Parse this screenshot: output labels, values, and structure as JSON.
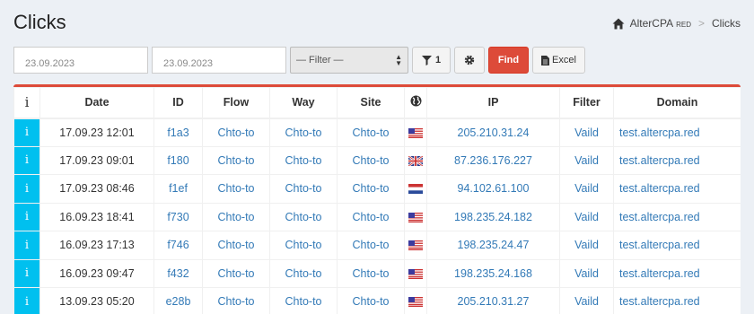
{
  "page": {
    "title": "Clicks"
  },
  "breadcrumb": {
    "brand": "AlterCPA",
    "brand_suffix": "RED",
    "separator": ">",
    "current": "Clicks",
    "home_icon": "home-icon"
  },
  "toolbar": {
    "date_from": "23.09.2023",
    "date_to": "23.09.2023",
    "filter_selected": "— Filter —",
    "filter_count": "1",
    "find_label": "Find",
    "excel_label": "Excel",
    "colors": {
      "find": "#dd4b39"
    }
  },
  "table": {
    "headers": {
      "info": "i",
      "date": "Date",
      "id": "ID",
      "flow": "Flow",
      "way": "Way",
      "site": "Site",
      "geo_icon": "globe-icon",
      "ip": "IP",
      "filter": "Filter",
      "domain": "Domain"
    },
    "rows": [
      {
        "info": "i",
        "date": "17.09.23 12:01",
        "id": "f1a3",
        "flow": "Chto-to",
        "way": "Chto-to",
        "site": "Chto-to",
        "flag": "us",
        "ip": "205.210.31.24",
        "filter": "Vaild",
        "domain": "test.altercpa.red"
      },
      {
        "info": "i",
        "date": "17.09.23 09:01",
        "id": "f180",
        "flow": "Chto-to",
        "way": "Chto-to",
        "site": "Chto-to",
        "flag": "gb",
        "ip": "87.236.176.227",
        "filter": "Vaild",
        "domain": "test.altercpa.red"
      },
      {
        "info": "i",
        "date": "17.09.23 08:46",
        "id": "f1ef",
        "flow": "Chto-to",
        "way": "Chto-to",
        "site": "Chto-to",
        "flag": "nl",
        "ip": "94.102.61.100",
        "filter": "Vaild",
        "domain": "test.altercpa.red"
      },
      {
        "info": "i",
        "date": "16.09.23 18:41",
        "id": "f730",
        "flow": "Chto-to",
        "way": "Chto-to",
        "site": "Chto-to",
        "flag": "us",
        "ip": "198.235.24.182",
        "filter": "Vaild",
        "domain": "test.altercpa.red"
      },
      {
        "info": "i",
        "date": "16.09.23 17:13",
        "id": "f746",
        "flow": "Chto-to",
        "way": "Chto-to",
        "site": "Chto-to",
        "flag": "us",
        "ip": "198.235.24.47",
        "filter": "Vaild",
        "domain": "test.altercpa.red"
      },
      {
        "info": "i",
        "date": "16.09.23 09:47",
        "id": "f432",
        "flow": "Chto-to",
        "way": "Chto-to",
        "site": "Chto-to",
        "flag": "us",
        "ip": "198.235.24.168",
        "filter": "Vaild",
        "domain": "test.altercpa.red"
      },
      {
        "info": "i",
        "date": "13.09.23 05:20",
        "id": "e28b",
        "flow": "Chto-to",
        "way": "Chto-to",
        "site": "Chto-to",
        "flag": "us",
        "ip": "205.210.31.27",
        "filter": "Vaild",
        "domain": "test.altercpa.red"
      }
    ]
  }
}
